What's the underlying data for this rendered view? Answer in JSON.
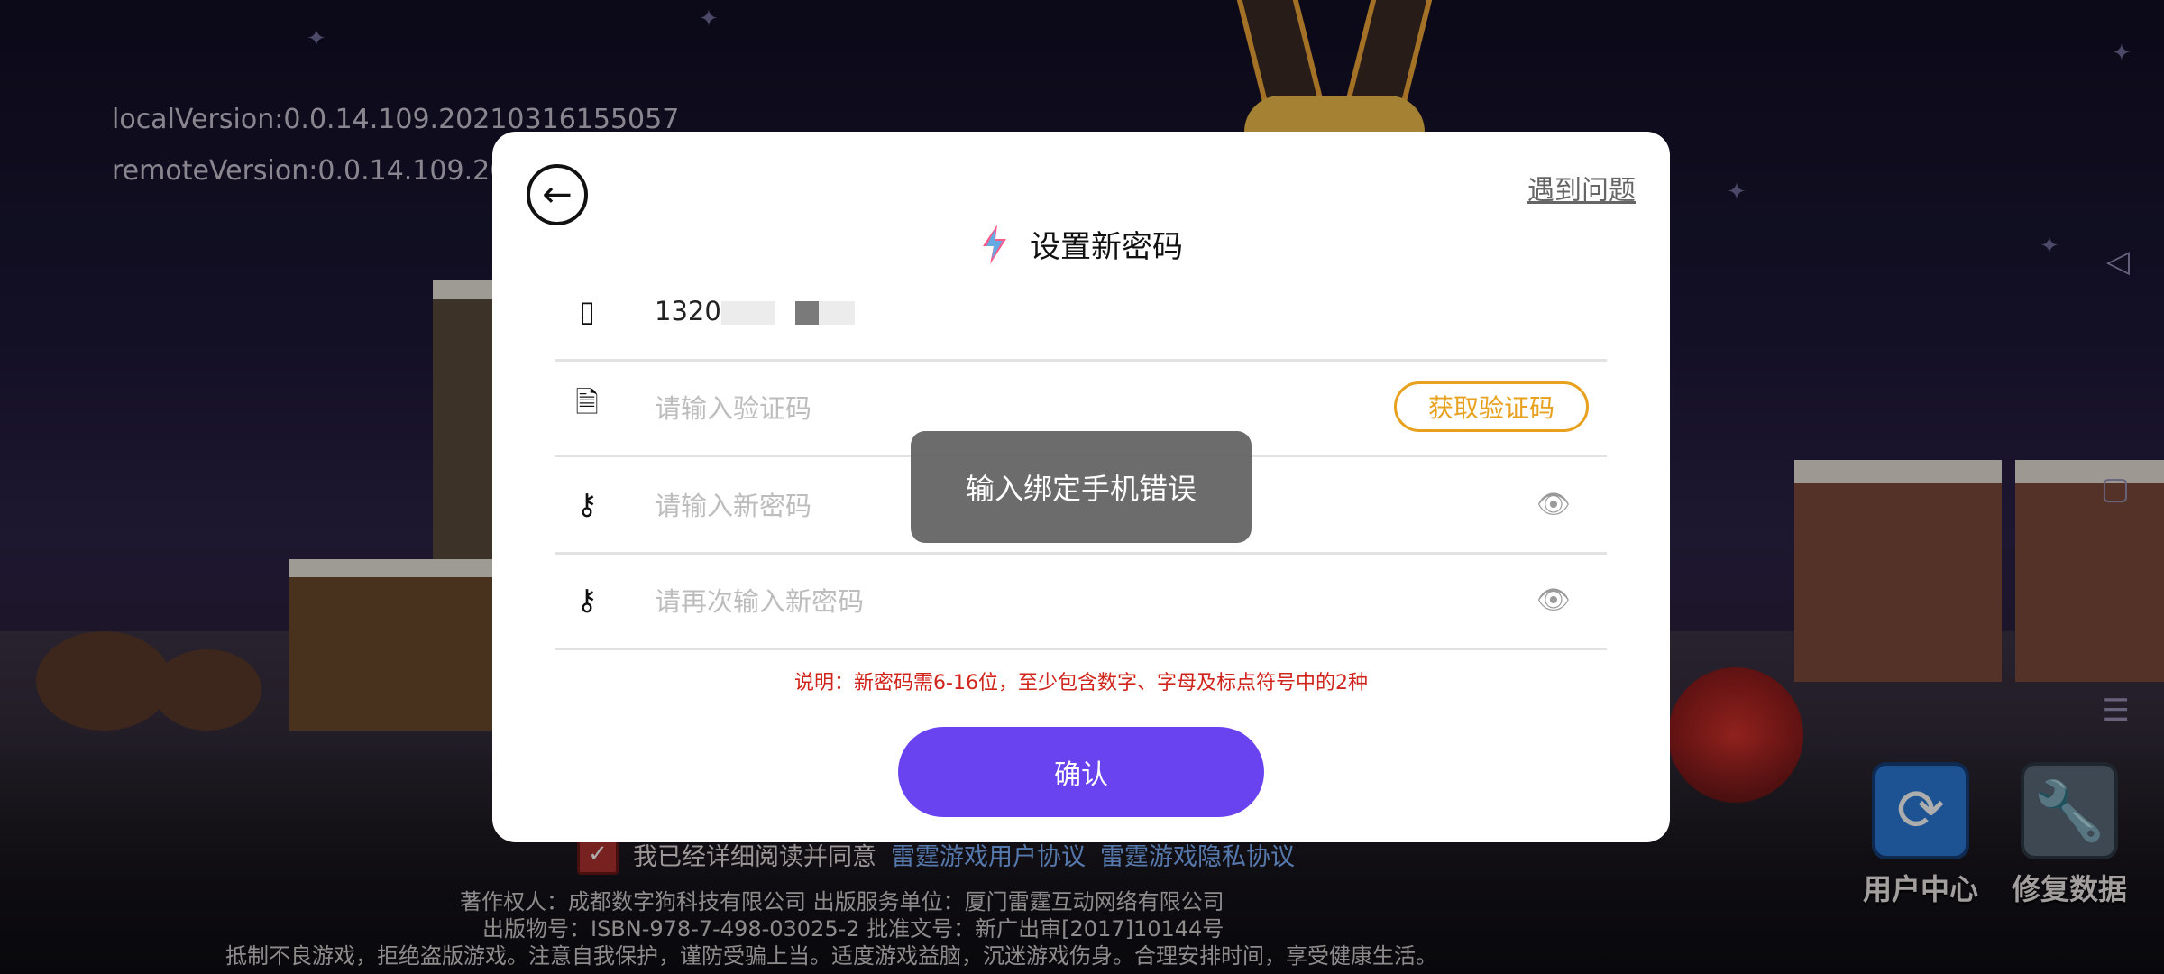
{
  "background": {
    "local_version": "localVersion:0.0.14.109.20210316155057",
    "remote_version": "remoteVersion:0.0.14.109.20",
    "agreement": {
      "text": "我已经详细阅读并同意",
      "link1": "雷霆游戏用户协议",
      "link2": "雷霆游戏隐私协议"
    },
    "copyright_lines": [
      "著作权人：成都数字狗科技有限公司 出版服务单位：厦门雷霆互动网络有限公司",
      "出版物号：ISBN-978-7-498-03025-2 批准文号：新广出审[2017]10144号",
      "抵制不良游戏，拒绝盗版游戏。注意自我保护，谨防受骗上当。适度游戏益脑，沉迷游戏伤身。合理安排时间，享受健康生活。"
    ],
    "buttons": {
      "user_center": "用户中心",
      "repair_data": "修复数据"
    }
  },
  "dialog": {
    "help_link": "遇到问题",
    "title": "设置新密码",
    "phone_value": "1320",
    "code_placeholder": "请输入验证码",
    "get_code_button": "获取验证码",
    "new_password_placeholder": "请输入新密码",
    "confirm_password_placeholder": "请再次输入新密码",
    "note": "说明：新密码需6-16位，至少包含数字、字母及标点符号中的2种",
    "confirm_button": "确认"
  },
  "toast": {
    "message": "输入绑定手机错误"
  },
  "colors": {
    "accent_purple": "#6a43f0",
    "code_button_orange": "#e7a11e",
    "note_red": "#d0251c"
  },
  "icons": {
    "back": "arrow-left-circle-icon",
    "title": "lightning-icon",
    "phone": "mobile-phone-icon",
    "code": "document-icon",
    "password": "key-icon",
    "visibility": "eye-icon"
  }
}
